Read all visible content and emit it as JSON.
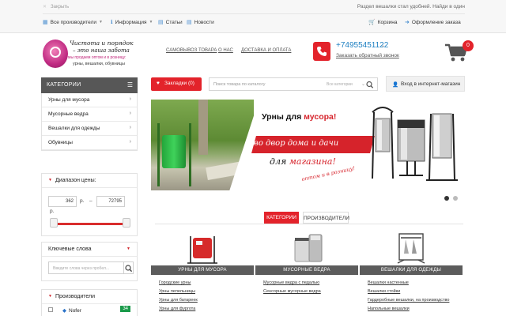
{
  "topbar": {
    "close_text": "Закрыть",
    "announcement": "Раздел вешалки стал удобней. Найди в один",
    "nav": [
      {
        "label": "Все производители"
      },
      {
        "label": "Информация"
      },
      {
        "label": "Статьи"
      },
      {
        "label": "Новости"
      },
      {
        "label": "Корзина"
      },
      {
        "label": "Оформление заказа"
      }
    ]
  },
  "header": {
    "logo_line1": "Чистота и порядок",
    "logo_line2": "– это наша забота",
    "logo_line3": "мы продаем оптом и в розницу:",
    "logo_line4": "урны, вешалки, обувницы",
    "links": [
      "САМОВЫВОЗ ТОВАРА",
      "О НАС",
      "ДОСТАВКА И ОПЛАТА"
    ],
    "phone": "+74955451122",
    "callback": "Заказать обратный звонок",
    "cart_count": "0"
  },
  "sidebar": {
    "categories_title": "КАТЕГОРИИ",
    "categories": [
      "Урны для мусора",
      "Мусорные ведра",
      "Вешалки для одежды",
      "Обувницы"
    ],
    "price_title": "Диапазон цены:",
    "price_min": "362",
    "price_max": "72795",
    "price_unit": "р.",
    "price_dash": "–",
    "keywords_title": "Ключевые слова",
    "keywords_placeholder": "Введите слова через пробел...",
    "manufacturers_title": "Производители",
    "manufacturer": "Nofer",
    "manufacturer_count": "34"
  },
  "search": {
    "bookmarks_label": "Закладки (0)",
    "placeholder": "Поиск товара по каталогу",
    "categories_label": "Все категории",
    "login_label": "Вход в интернет-магазин"
  },
  "banner": {
    "line1_a": "Урны для ",
    "line1_b": "мусора!",
    "line2": "во двор дома и дачи",
    "line3_a": "для ",
    "line3_b": "магазина!",
    "line4": "оптом и в розницу!"
  },
  "tabs": [
    "КАТЕГОРИИ",
    "ПРОИЗВОДИТЕЛИ"
  ],
  "cards": [
    {
      "title": "УРНЫ ДЛЯ МУСОРА",
      "links": [
        "Городские урны",
        "Урны пепельницы",
        "Урны для батареек",
        "Урны для фургота"
      ]
    },
    {
      "title": "МУСОРНЫЕ ВЕДРА",
      "links": [
        "Мусорные ведра с педалью",
        "Сенсорные мусорные ведра"
      ]
    },
    {
      "title": "ВЕШАЛКИ ДЛЯ ОДЕЖДЫ",
      "links": [
        "Вешалки настенные",
        "Вешалки стойки",
        "Гардеробные вешалки, на производство",
        "Напольные вешалки"
      ]
    }
  ],
  "colors": {
    "accent": "#e3232b",
    "link_blue": "#1d7fc1",
    "dark_band": "#575757",
    "badge_green": "#1a9a4a"
  }
}
